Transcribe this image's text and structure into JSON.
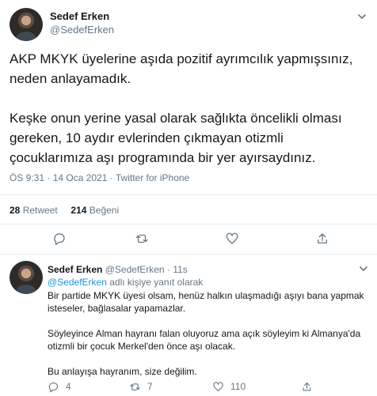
{
  "tweet": {
    "author_name": "Sedef Erken",
    "author_handle": "@SedefErken",
    "text": "AKP MKYK üyelerine aşıda pozitif ayrımcılık yapmışsınız,\nneden anlayamadık.\n\nKeşke onun yerine yasal olarak sağlıkta öncelikli olması\ngereken, 10 aydır evlerinden çıkmayan otizmli\nçocuklarımıza aşı programında bir yer ayırsaydınız.",
    "timestamp": "ÖS 9:31 · 14 Oca 2021 · Twitter for iPhone",
    "retweets_count": "28",
    "retweets_label": "Retweet",
    "likes_count": "214",
    "likes_label": "Beğeni",
    "icons": [
      "chevron-down-icon",
      "reply-icon",
      "retweet-icon",
      "like-icon",
      "share-icon"
    ]
  },
  "reply": {
    "author_name": "Sedef Erken",
    "author_handle": "@SedefErken · 11s",
    "replying_to_handle": "@SedefErken",
    "replying_to_suffix": "adlı kişiye yanıt olarak",
    "text": "Bir partide MKYK üyesi olsam, henüz halkın ulaşmadığı aşıyı bana yapmak\nisteseler, bağlasalar yapamazlar.\n\nSöyleyince Alman hayranı falan oluyoruz ama açık söyleyim ki Almanya'da\notizmli bir çocuk Merkel'den önce aşı olacak.\n\nBu anlayışa hayranım, size değilim.",
    "reply_count": "4",
    "retweet_count": "7",
    "like_count": "110"
  },
  "colors": {
    "text": "#14171a",
    "muted": "#657786",
    "link": "#1b95e0",
    "divider": "#e6ecf0"
  }
}
